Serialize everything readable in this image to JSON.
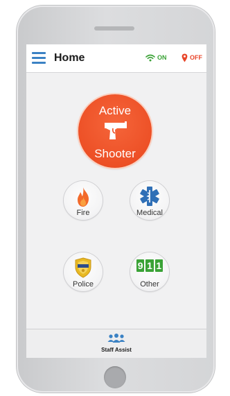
{
  "header": {
    "title": "Home",
    "wifi_status": "ON",
    "location_status": "OFF"
  },
  "main_alert": {
    "line1": "Active",
    "line2": "Shooter"
  },
  "buttons": [
    {
      "label": "Fire",
      "icon": "flame-icon"
    },
    {
      "label": "Medical",
      "icon": "star-of-life-icon"
    },
    {
      "label": "Police",
      "icon": "police-badge-icon"
    },
    {
      "label": "Other",
      "icon": "911-icon",
      "digits": [
        "9",
        "1",
        "1"
      ]
    }
  ],
  "footer": {
    "label": "Staff Assist",
    "icon": "group-icon"
  },
  "colors": {
    "accent_blue": "#3b82c4",
    "alert_orange": "#ed5026",
    "status_on": "#3aa236",
    "status_off": "#e8462a",
    "fire": "#f26a2b",
    "medical": "#2f6fb6",
    "police_gold": "#e8b923",
    "other_green": "#3aa236"
  }
}
